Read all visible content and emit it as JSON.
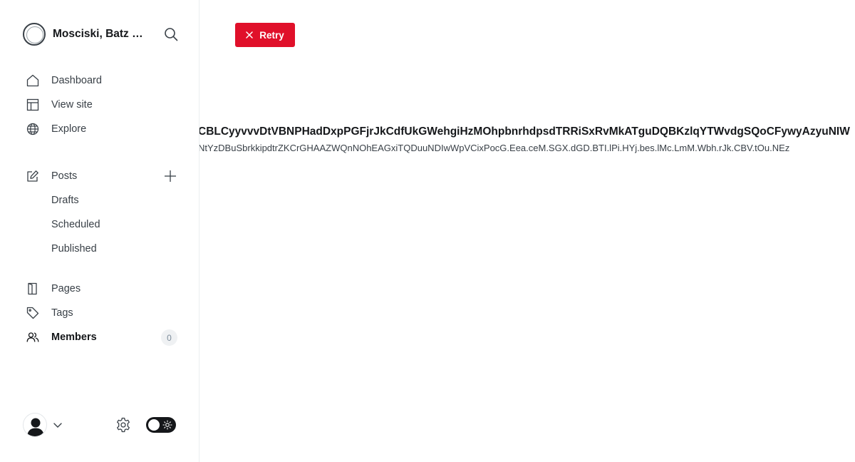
{
  "site": {
    "title": "Mosciski, Batz and Sons"
  },
  "nav": {
    "primary": [
      {
        "label": "Dashboard",
        "icon": "home-icon"
      },
      {
        "label": "View site",
        "icon": "layout-icon"
      },
      {
        "label": "Explore",
        "icon": "globe-icon"
      }
    ],
    "posts": {
      "label": "Posts",
      "sub": [
        "Drafts",
        "Scheduled",
        "Published"
      ]
    },
    "secondary": [
      {
        "label": "Pages",
        "icon": "pages-icon"
      },
      {
        "label": "Tags",
        "icon": "tag-icon"
      },
      {
        "label": "Members",
        "icon": "members-icon",
        "count": "0",
        "active": true
      }
    ]
  },
  "main": {
    "retry_label": "Retry",
    "post_title": "CBLCyyvvvDtVBNPHadDxpPGFjrJkCdfUkGWehgiHzMOhpbnrhdpsdTRRiSxRvMkATguDQBKzlqYTWvdgSQoCFywyAzyuNIW",
    "post_meta": "NtYzDBuSbrkkipdtrZKCrGHAAZWQnNOhEAGxiTQDuuNDIwWpVCixPocG.Eea.ceM.SGX.dGD.BTI.lPi.HYj.bes.lMc.LmM.Wbh.rJk.CBV.tOu.NEz"
  },
  "colors": {
    "accent": "#e0102a",
    "text": "#15171a",
    "muted": "#394047",
    "toggle": "#15171a"
  }
}
